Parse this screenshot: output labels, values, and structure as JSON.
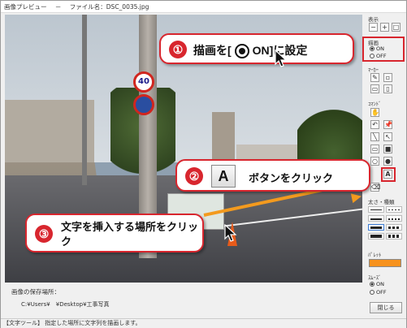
{
  "window": {
    "app_title": "画像プレビュー",
    "separator": "－",
    "file_label": "ファイル名：DSC_0035.jpg"
  },
  "photo": {
    "sign_speed": "40"
  },
  "callouts": [
    {
      "number": "①",
      "text_before": "描画を[",
      "text_after": "ON]に設定"
    },
    {
      "number": "②",
      "button_glyph": "A",
      "text": "ボタンをクリック"
    },
    {
      "number": "③",
      "text": "文字を挿入する場所をクリック"
    }
  ],
  "save": {
    "label": "画像の保存場所：",
    "path": "C:¥Users¥　¥Desktop¥工事写真"
  },
  "status": "【文字ツール】 指定した場所に文字列を描画します。",
  "panel": {
    "display_label": "表示",
    "draw_label": "描画",
    "draw_options": [
      "ON",
      "OFF"
    ],
    "draw_selected": "ON",
    "marker_label": "ﾏｰｶｰ",
    "command_label": "ｺﾏﾝﾄﾞ",
    "text_button": "A",
    "line_label": "太さ・種類",
    "palette_label": "ﾊﾟﾚｯﾄ",
    "palette_color": "#f7921e",
    "smooth_label": "ｽﾑｰｽﾞ",
    "smooth_options": [
      "ON",
      "OFF"
    ],
    "smooth_selected": "ON",
    "close_label": "閉じる"
  },
  "colors": {
    "accent_red": "#d8262e",
    "arrow_orange": "#f39a1e"
  }
}
